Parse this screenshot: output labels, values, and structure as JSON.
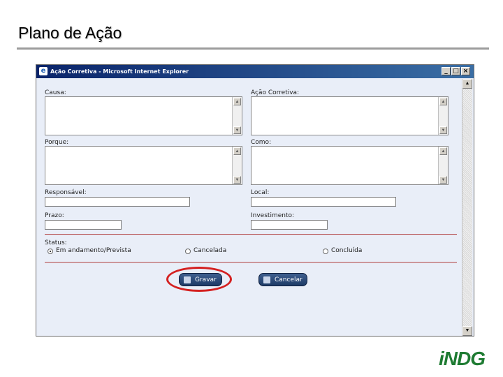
{
  "slide": {
    "title": "Plano de Ação"
  },
  "window": {
    "title": "Ação Corretiva - Microsoft Internet Explorer",
    "buttons": {
      "minimize": "_",
      "maximize": "□",
      "close": "×"
    }
  },
  "form": {
    "causa_label": "Causa:",
    "acao_label": "Ação Corretiva:",
    "porque_label": "Porque:",
    "como_label": "Como:",
    "responsavel_label": "Responsável:",
    "local_label": "Local:",
    "prazo_label": "Prazo:",
    "investimento_label": "Investimento:",
    "status_label": "Status:",
    "status_options": [
      "Em andamento/Prevista",
      "Cancelada",
      "Concluída"
    ],
    "status_selected": "Em andamento/Prevista",
    "save_label": "Gravar",
    "cancel_label": "Cancelar"
  },
  "logo": {
    "text": "iNDG",
    "color": "#1e7b32"
  }
}
